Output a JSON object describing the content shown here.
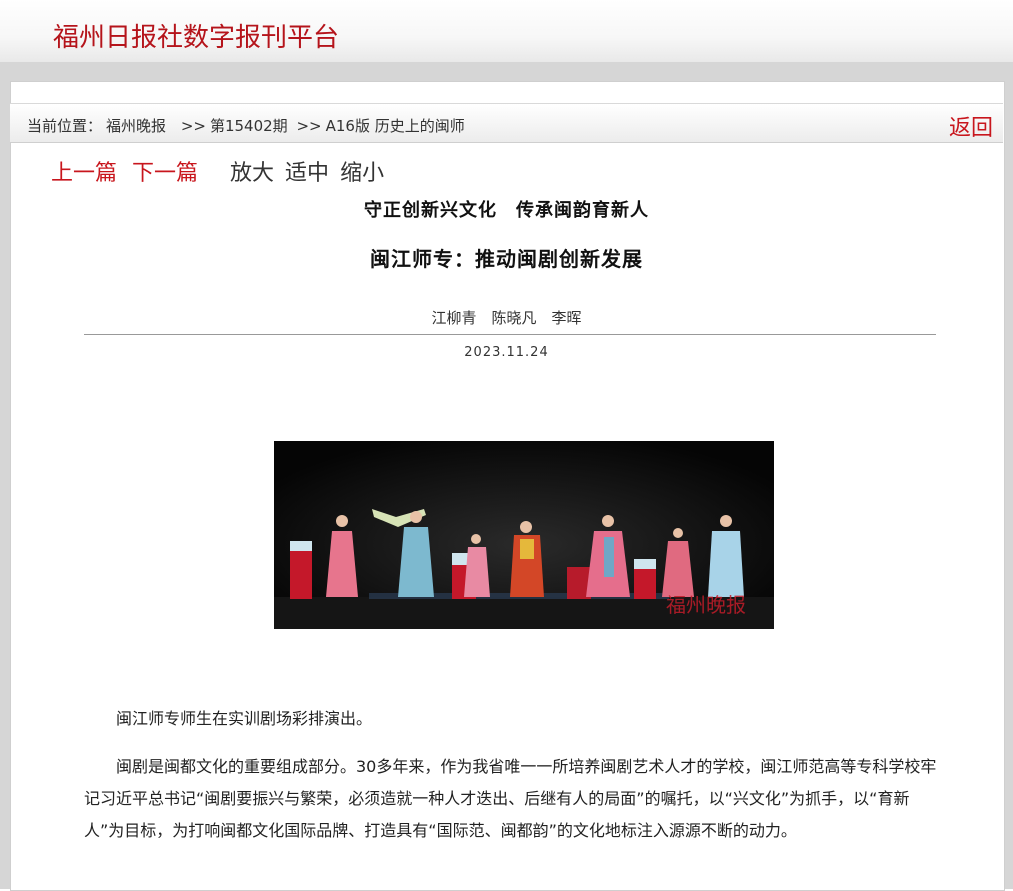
{
  "header": {
    "site_title": "福州日报社数字报刊平台"
  },
  "breadcrumb": {
    "prefix": "当前位置：",
    "paper": "福州晚报",
    "sep1": ">>",
    "issue": "第15402期",
    "sep2": ">>",
    "page": "A16版 历史上的闽师",
    "back_label": "返回"
  },
  "nav": {
    "prev_label": "上一篇",
    "next_label": "下一篇",
    "zoom_in_label": "放大",
    "zoom_fit_label": "适中",
    "zoom_out_label": "缩小"
  },
  "article": {
    "subtitle": "守正创新兴文化　传承闽韵育新人",
    "title": "闽江师专：推动闽剧创新发展",
    "authors": "江柳青　陈晓凡　李晖",
    "date": "2023.11.24",
    "photo_watermark": "福州晚报",
    "caption": "闽江师专师生在实训剧场彩排演出。",
    "paragraph1": "闽剧是闽都文化的重要组成部分。30多年来，作为我省唯一一所培养闽剧艺术人才的学校，闽江师范高等专科学校牢记习近平总书记“闽剧要振兴与繁荣，必须造就一种人才迭出、后继有人的局面”的嘱托，以“兴文化”为抓手，以“育新人”为目标，为打响闽都文化国际品牌、打造具有“国际范、闽都韵”的文化地标注入源源不断的动力。"
  },
  "colors": {
    "accent_red": "#c8161d",
    "title_red": "#b5141b"
  }
}
